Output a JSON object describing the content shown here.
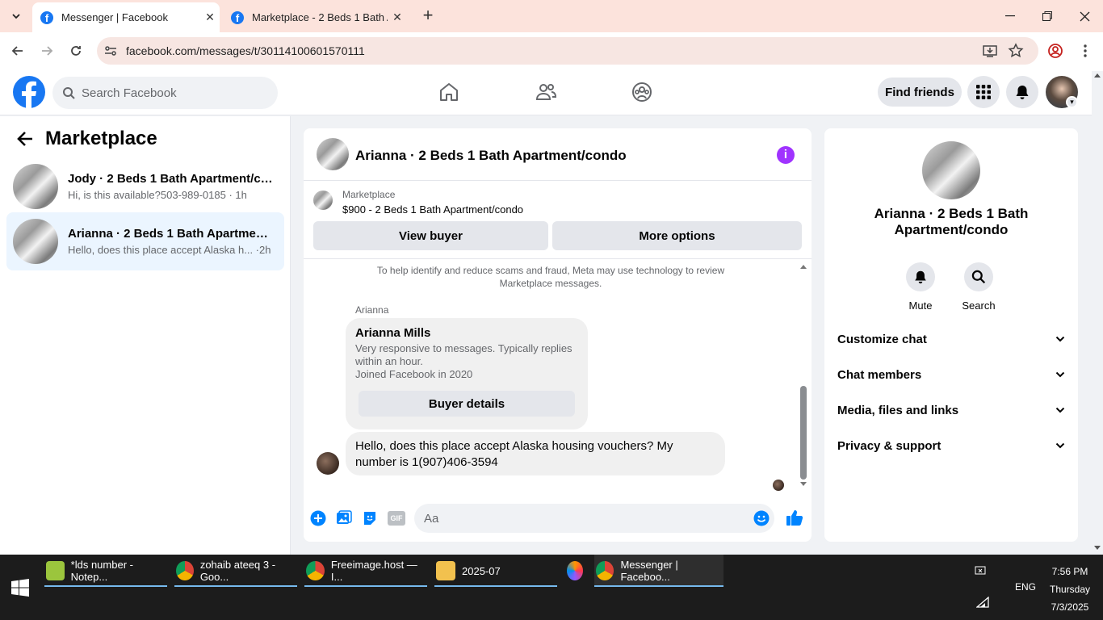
{
  "browser": {
    "tabs": [
      {
        "title": "Messenger | Facebook",
        "active": true
      },
      {
        "title": "Marketplace - 2 Beds 1 Bath Ap",
        "active": false
      }
    ],
    "url": "facebook.com/messages/t/30114100601570111"
  },
  "fb_header": {
    "search_placeholder": "Search Facebook",
    "find_friends": "Find friends"
  },
  "left_panel": {
    "title": "Marketplace",
    "conversations": [
      {
        "name": "Jody · 2 Beds 1 Bath Apartment/co...",
        "preview": "Hi, is this available?503-989-0185 · 1h",
        "selected": false
      },
      {
        "name": "Arianna · 2 Beds 1 Bath Apartment...",
        "preview": "Hello, does this place accept Alaska h... ·2h",
        "selected": true
      }
    ]
  },
  "chat": {
    "title": "Arianna · 2 Beds 1 Bath Apartment/condo",
    "listing_source": "Marketplace",
    "listing_price": "$900 - 2 Beds 1 Bath Apartment/condo",
    "view_buyer": "View buyer",
    "more_options": "More options",
    "notice": "To help identify and reduce scams and fraud, Meta may use technology to review Marketplace messages.",
    "sender_label": "Arianna",
    "buyer_card": {
      "name": "Arianna Mills",
      "description": "Very responsive to messages. Typically replies within an hour.",
      "joined": "Joined Facebook in 2020",
      "button": "Buyer details"
    },
    "message": "Hello, does this place accept Alaska housing vouchers? My number is 1(907)406-3594",
    "input_placeholder": "Aa",
    "gif_label": "GIF"
  },
  "right_panel": {
    "title": "Arianna · 2 Beds 1 Bath Apartment/condo",
    "actions": [
      {
        "label": "Mute",
        "icon": "bell-icon"
      },
      {
        "label": "Search",
        "icon": "search-icon"
      }
    ],
    "sections": [
      "Customize chat",
      "Chat members",
      "Media, files and links",
      "Privacy & support"
    ]
  },
  "taskbar": {
    "items": [
      {
        "label": "*lds number - Notep..."
      },
      {
        "label": "zohaib ateeq 3 - Goo..."
      },
      {
        "label": "Freeimage.host — I..."
      },
      {
        "label": "2025-07"
      },
      {
        "label": "Messenger | Faceboo..."
      }
    ],
    "language": "ENG",
    "time": "7:56 PM",
    "day": "Thursday",
    "date": "7/3/2025"
  },
  "colors": {
    "fb_blue": "#1877f2",
    "messenger_blue": "#0084ff",
    "info_purple": "#a033ff",
    "selected_row": "#ebf5ff"
  }
}
